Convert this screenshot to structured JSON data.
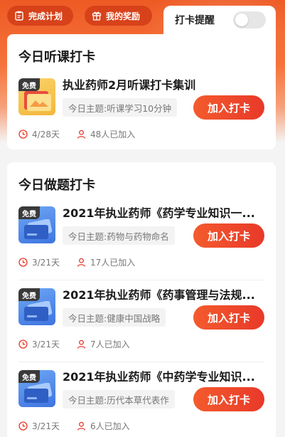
{
  "header": {
    "plan_label": "完成计划",
    "reward_label": "我的奖励",
    "reminder_label": "打卡提醒",
    "reminder_on": false
  },
  "listen_section": {
    "title": "今日听课打卡",
    "items": [
      {
        "badge": "免费",
        "title": "执业药师2月听课打卡集训",
        "topic": "今日主题:听课学习10分钟",
        "button": "加入打卡",
        "progress": "4/28天",
        "joined": "48人已加入"
      }
    ]
  },
  "question_section": {
    "title": "今日做题打卡",
    "items": [
      {
        "badge": "免费",
        "title": "2021年执业药师《药学专业知识一...",
        "topic": "今日主题:药物与药物命名",
        "button": "加入打卡",
        "progress": "3/21天",
        "joined": "17人已加入"
      },
      {
        "badge": "免费",
        "title": "2021年执业药师《药事管理与法规...",
        "topic": "今日主题:健康中国战略",
        "button": "加入打卡",
        "progress": "3/21天",
        "joined": "7人已加入"
      },
      {
        "badge": "免费",
        "title": "2021年执业药师《中药学专业知识...",
        "topic": "今日主题:历代本草代表作",
        "button": "加入打卡",
        "progress": "3/21天",
        "joined": "6人已加入"
      }
    ]
  },
  "colors": {
    "accent": "#ee4a2b",
    "header_bg": "#ee5a24"
  }
}
